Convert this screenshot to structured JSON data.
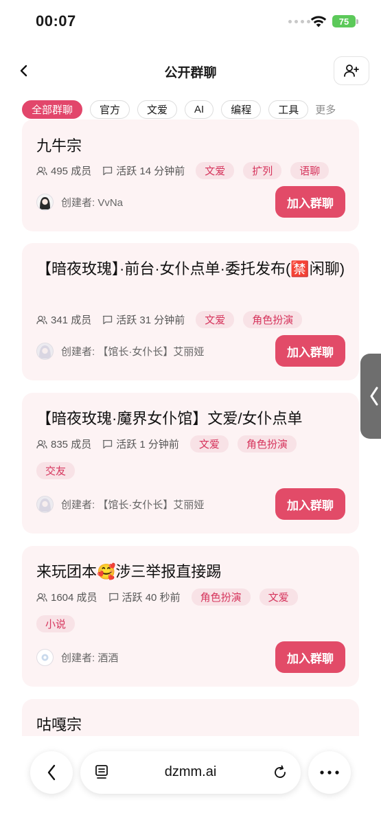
{
  "status": {
    "time": "00:07",
    "battery": "75"
  },
  "nav": {
    "title": "公开群聊"
  },
  "filters": {
    "chips": [
      "全部群聊",
      "官方",
      "文爱",
      "AI",
      "编程",
      "工具"
    ],
    "more": "更多"
  },
  "groups": [
    {
      "title": "九牛宗",
      "members": "495 成员",
      "active": "活跃 14 分钟前",
      "tags": [
        "文爱",
        "扩列",
        "语聊"
      ],
      "creator": "创建者: VvNa",
      "join": "加入群聊"
    },
    {
      "title": "【暗夜玫瑰】·前台·女仆点单·委托发布(🈲闲聊)",
      "members": "341 成员",
      "active": "活跃 31 分钟前",
      "tags": [
        "文爱",
        "角色扮演"
      ],
      "creator": "创建者: 【馆长·女仆长】艾丽娅",
      "join": "加入群聊"
    },
    {
      "title": "【暗夜玫瑰·魔界女仆馆】文爱/女仆点单",
      "members": "835 成员",
      "active": "活跃 1 分钟前",
      "tags": [
        "文爱",
        "角色扮演",
        "交友"
      ],
      "creator": "创建者: 【馆长·女仆长】艾丽娅",
      "join": "加入群聊"
    },
    {
      "title": "来玩团本🥰涉三举报直接踢",
      "members": "1604 成员",
      "active": "活跃 40 秒前",
      "tags": [
        "角色扮演",
        "文爱",
        "小说"
      ],
      "creator": "创建者: 酒酒",
      "join": "加入群聊"
    },
    {
      "title": "咕嘎宗"
    }
  ],
  "browser": {
    "url": "dzmm.ai"
  },
  "colors": {
    "accent": "#e24b68",
    "card_bg": "#fdf3f4",
    "tag_bg": "#f8e2e6"
  }
}
